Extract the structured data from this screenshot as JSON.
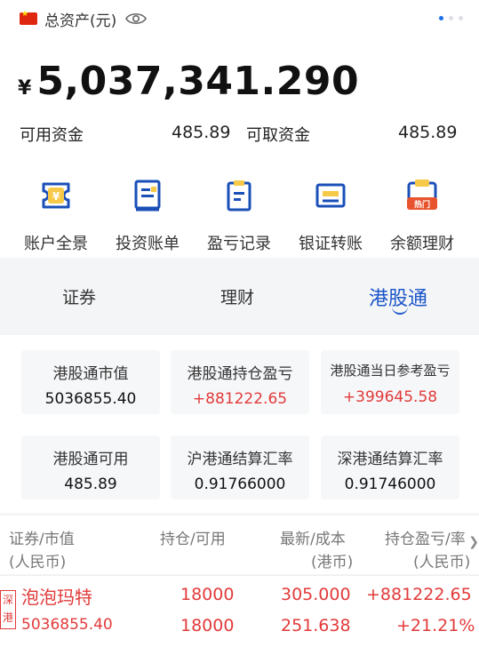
{
  "header": {
    "title": "总资产(元)",
    "currency_symbol": "¥",
    "total_amount": "5,037,341.290"
  },
  "funds": {
    "available_label": "可用资金",
    "available_value": "485.89",
    "withdrawable_label": "可取资金",
    "withdrawable_value": "485.89"
  },
  "quick_actions": [
    {
      "label": "账户全景",
      "icon": "wallet-icon"
    },
    {
      "label": "投资账单",
      "icon": "bill-icon"
    },
    {
      "label": "盈亏记录",
      "icon": "record-icon"
    },
    {
      "label": "银证转账",
      "icon": "transfer-icon"
    },
    {
      "label": "余额理财",
      "icon": "wealth-icon",
      "badge": "热门"
    }
  ],
  "tabs": [
    {
      "label": "证券"
    },
    {
      "label": "理财"
    },
    {
      "label": "港股通",
      "active": true
    }
  ],
  "stats": [
    {
      "label": "港股通市值",
      "value": "5036855.40"
    },
    {
      "label": "港股通持仓盈亏",
      "value": "+881222.65"
    },
    {
      "label": "港股通当日参考盈亏",
      "value": "+399645.58"
    },
    {
      "label": "港股通可用",
      "value": "485.89"
    },
    {
      "label": "沪港通结算汇率",
      "value": "0.91766000"
    },
    {
      "label": "深港通结算汇率",
      "value": "0.91746000"
    }
  ],
  "columns": {
    "c1_line1": "证券/市值",
    "c1_line2": "(人民币)",
    "c2_line1": "持仓/可用",
    "c3_line1": "最新/成本",
    "c3_line2": "(港币)",
    "c4_line1": "持仓盈亏/率",
    "c4_line2": "(人民币)"
  },
  "holdings": [
    {
      "market_tag": "深港",
      "name": "泡泡玛特",
      "market_value": "5036855.40",
      "position": "18000",
      "available": "18000",
      "latest": "305.000",
      "cost": "251.638",
      "pnl": "+881222.65",
      "pnl_rate": "+21.21%"
    }
  ],
  "colors": {
    "accent": "#1b56c9",
    "profit": "#e23a3a",
    "icon": "#1a4fb8",
    "badge": "#e8542e"
  }
}
